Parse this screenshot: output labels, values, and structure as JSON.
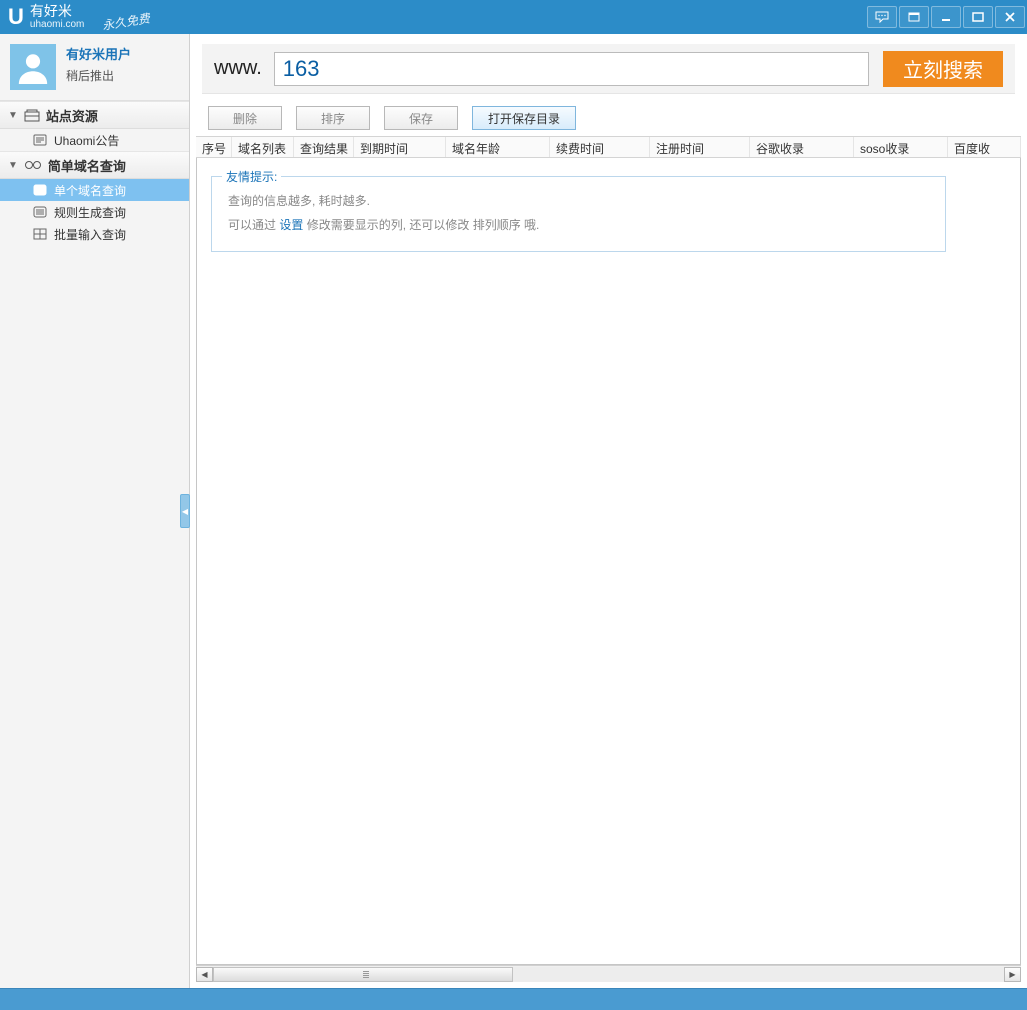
{
  "titlebar": {
    "brand_cn": "有好米",
    "brand_en": "uhaomi.com",
    "free_badge": "永久免费"
  },
  "user": {
    "name": "有好米用户",
    "sub": "稍后推出"
  },
  "sidebar": {
    "section1": {
      "label": "站点资源",
      "items": [
        "Uhaomi公告"
      ]
    },
    "section2": {
      "label": "简单域名查询",
      "items": [
        "单个域名查询",
        "规则生成查询",
        "批量输入查询"
      ],
      "selected_index": 0
    }
  },
  "search": {
    "prefix": "www.",
    "value": "163",
    "button": "立刻搜索"
  },
  "actions": {
    "delete": "删除",
    "sort": "排序",
    "save": "保存",
    "open_dir": "打开保存目录"
  },
  "columns": [
    "序号",
    "域名列表",
    "查询结果",
    "到期时间",
    "域名年龄",
    "续费时间",
    "注册时间",
    "谷歌收录",
    "soso收录",
    "百度收"
  ],
  "tip": {
    "title": "友情提示:",
    "line1": "查询的信息越多, 耗时越多.",
    "line2_a": "可以通过 ",
    "line2_link": "设置",
    "line2_b": " 修改需要显示的列, 还可以修改  排列顺序  哦."
  }
}
